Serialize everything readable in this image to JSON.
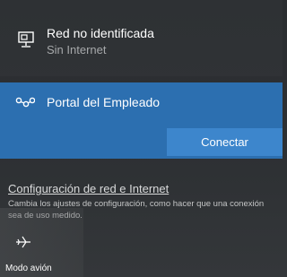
{
  "networks": {
    "ethernet": {
      "name": "Red no identificada",
      "status": "Sin Internet",
      "icon": "ethernet-icon"
    },
    "wifi": {
      "name": "Portal del Empleado",
      "icon": "wifi-network-icon",
      "connect_label": "Conectar",
      "accent_color": "#2c6fb0"
    }
  },
  "settings": {
    "link_label": "Configuración de red e Internet",
    "description": "Cambia los ajustes de configuración, como hacer que una conexión sea de uso medido."
  },
  "quick_actions": [
    {
      "label": "Modo avión",
      "icon": "airplane-icon"
    }
  ]
}
